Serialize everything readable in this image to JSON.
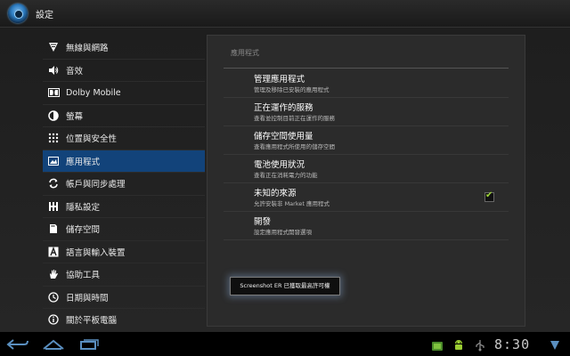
{
  "app": {
    "title": "設定"
  },
  "sidebar": {
    "items": [
      {
        "label": "無線與網路",
        "icon": "wifi-icon"
      },
      {
        "label": "音效",
        "icon": "speaker-icon"
      },
      {
        "label": "Dolby Mobile",
        "icon": "dolby-icon"
      },
      {
        "label": "螢幕",
        "icon": "brightness-icon"
      },
      {
        "label": "位置與安全性",
        "icon": "grid-dots-icon"
      },
      {
        "label": "應用程式",
        "icon": "apps-image-icon"
      },
      {
        "label": "帳戶與同步處理",
        "icon": "sync-icon"
      },
      {
        "label": "隱私設定",
        "icon": "privacy-grid-icon"
      },
      {
        "label": "儲存空間",
        "icon": "storage-icon"
      },
      {
        "label": "語言與輸入裝置",
        "icon": "keyboard-a-icon"
      },
      {
        "label": "協助工具",
        "icon": "hand-icon"
      },
      {
        "label": "日期與時間",
        "icon": "clock-icon"
      },
      {
        "label": "關於平板電腦",
        "icon": "info-icon"
      }
    ],
    "selected_index": 5
  },
  "panel": {
    "header": "應用程式",
    "prefs": [
      {
        "title": "管理應用程式",
        "summary": "管理及移除已安裝的應用程式"
      },
      {
        "title": "正在運作的服務",
        "summary": "查看並控制目前正在運作的服務"
      },
      {
        "title": "儲存空間使用量",
        "summary": "查看應用程式所使用的儲存空間"
      },
      {
        "title": "電池使用狀況",
        "summary": "查看正在消耗電力的功能"
      },
      {
        "title": "未知的來源",
        "summary": "允許安裝非 Market 應用程式",
        "checked": true
      },
      {
        "title": "開發",
        "summary": "設定應用程式開發選項"
      }
    ]
  },
  "toast": {
    "text": "Screenshot ER 已獲取最高許可權"
  },
  "system_bar": {
    "time": "8:30",
    "buttons": [
      "back-icon",
      "home-icon",
      "recent-apps-icon"
    ],
    "notifications": [
      "android-robot-icon",
      "android-robot-icon",
      "usb-icon"
    ]
  },
  "colors": {
    "accent": "#12437a",
    "check": "#9fd63b"
  }
}
